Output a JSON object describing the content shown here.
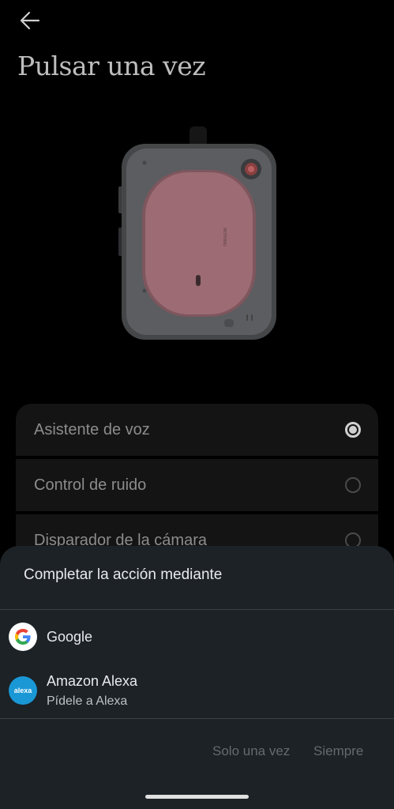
{
  "header": {
    "back_icon": "arrow-left-icon",
    "title": "Pulsar una vez"
  },
  "options": [
    {
      "label": "Asistente de voz",
      "selected": true
    },
    {
      "label": "Control de ruido",
      "selected": false
    },
    {
      "label": "Disparador de la cámara",
      "selected": false
    }
  ],
  "sheet": {
    "title": "Completar la acción mediante",
    "apps": [
      {
        "name": "Google",
        "subtitle": "",
        "icon": "google-icon"
      },
      {
        "name": "Amazon Alexa",
        "subtitle": "Pídele a Alexa",
        "icon": "alexa-icon",
        "icon_text": "alexa"
      }
    ],
    "once_label": "Solo una vez",
    "always_label": "Siempre"
  },
  "colors": {
    "background": "#000000",
    "sheet": "#1c2226",
    "alexa_blue": "#1a98d5",
    "device_pink": "#9c6b74"
  }
}
